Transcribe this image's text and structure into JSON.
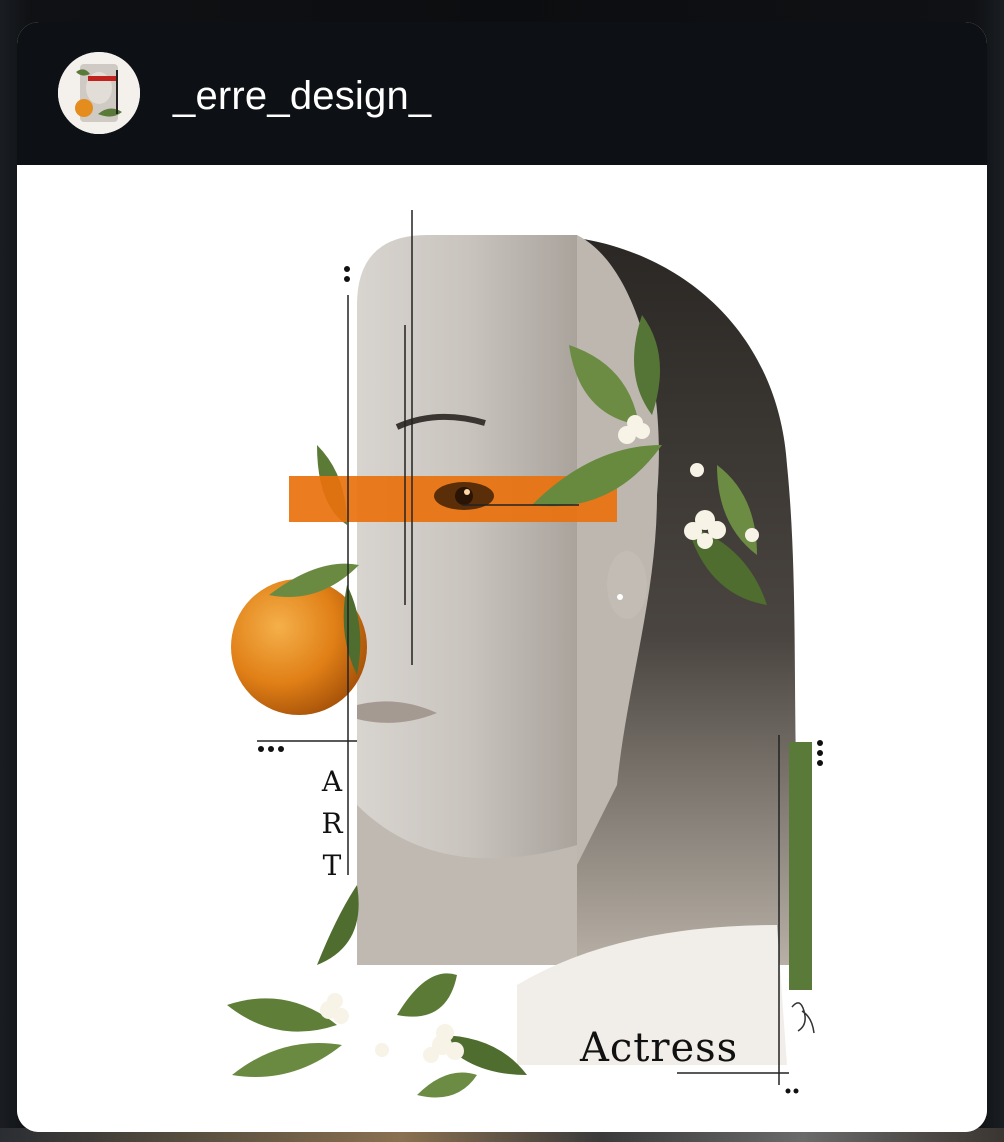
{
  "post": {
    "username": "_erre_design_",
    "artwork": {
      "vertical_word_letters": [
        "A",
        "R",
        "T"
      ],
      "caption_word": "Actress"
    }
  },
  "colors": {
    "header_bg": "#0d1014",
    "card_bg": "#ffffff",
    "accent_orange": "#e9710d",
    "accent_green": "#5a7a3a"
  },
  "icons": {
    "avatar": "profile-avatar"
  }
}
